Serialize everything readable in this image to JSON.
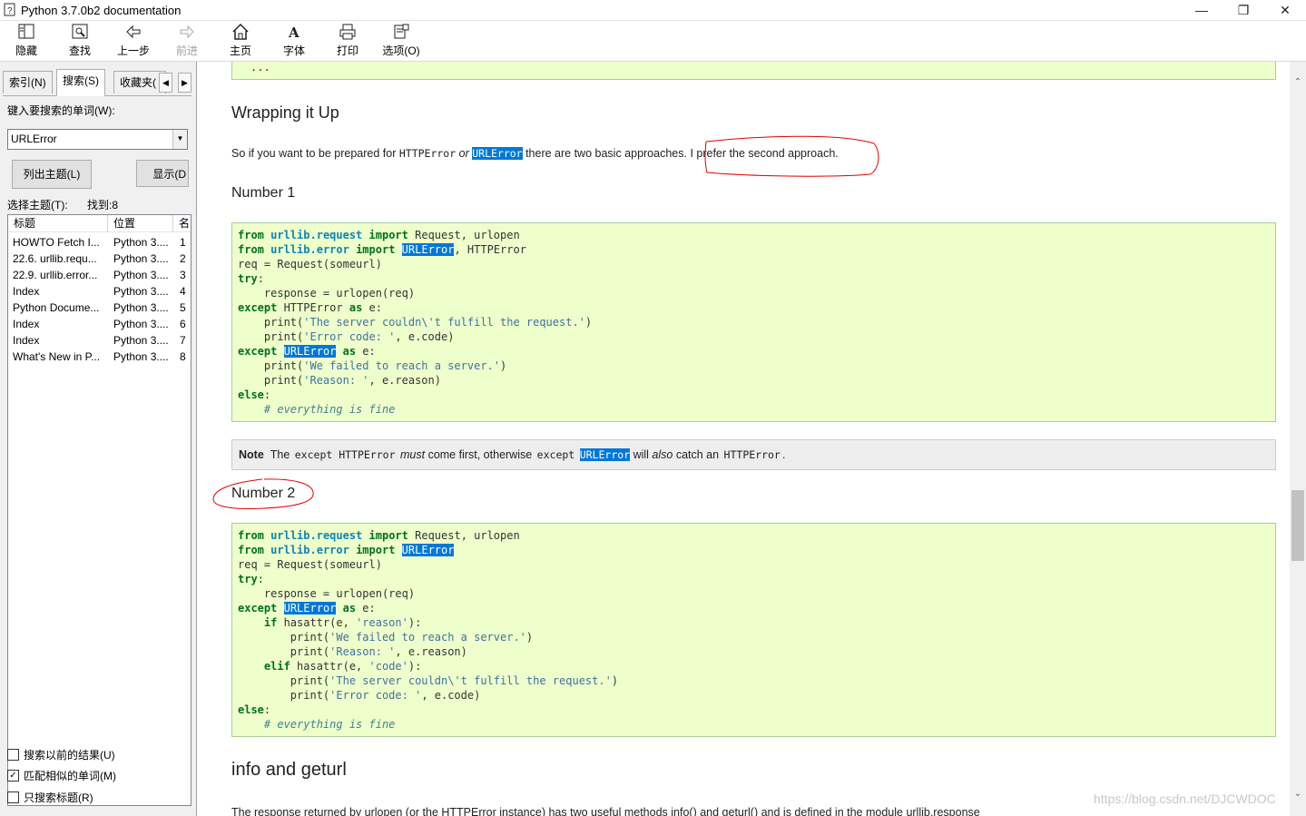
{
  "window": {
    "title": "Python 3.7.0b2 documentation"
  },
  "toolbar": {
    "hide": "隐藏",
    "find": "查找",
    "back": "上一步",
    "forward": "前进",
    "home": "主页",
    "font": "字体",
    "print": "打印",
    "options": "选项(O)"
  },
  "left": {
    "tabs": {
      "index": "索引(N)",
      "search": "搜索(S)",
      "favorites": "收藏夹("
    },
    "search_label": "键入要搜索的单词(W):",
    "search_value": "URLError",
    "list_topics_button": "列出主题(L)",
    "display_button": "显示(D",
    "select_topic_label": "选择主题(T):",
    "found_label": "找到:8",
    "columns": {
      "title": "标题",
      "location": "位置",
      "rank": "名"
    },
    "results": [
      {
        "title": "HOWTO Fetch I...",
        "location": "Python 3....",
        "rank": "1"
      },
      {
        "title": "22.6. urllib.requ...",
        "location": "Python 3....",
        "rank": "2"
      },
      {
        "title": "22.9. urllib.error...",
        "location": "Python 3....",
        "rank": "3"
      },
      {
        "title": "Index",
        "location": "Python 3....",
        "rank": "4"
      },
      {
        "title": "Python Docume...",
        "location": "Python 3....",
        "rank": "5"
      },
      {
        "title": "Index",
        "location": "Python 3....",
        "rank": "6"
      },
      {
        "title": "Index",
        "location": "Python 3....",
        "rank": "7"
      },
      {
        "title": "What's New in P...",
        "location": "Python 3....",
        "rank": "8"
      }
    ],
    "options": {
      "prev_results": "搜索以前的结果(U)",
      "match_similar": "匹配相似的单词(M)",
      "titles_only": "只搜索标题(R)"
    },
    "checked": {
      "prev_results": false,
      "match_similar": true,
      "titles_only": false
    }
  },
  "content": {
    "top_code": "...",
    "heading_wrap": "Wrapping it Up",
    "intro": {
      "a": "So if you want to be prepared for ",
      "httperror": "HTTPError",
      "or": " or ",
      "urlerror": "URLError",
      "b": " there are two basic approaches.",
      "c": " I prefer the second approach."
    },
    "number1": "Number 1",
    "note": {
      "label": "Note",
      "t1": "The ",
      "c1": "except HTTPError",
      "t2": " must",
      "t3": " come first, otherwise ",
      "c2": "except",
      "c3": "URLError",
      "t4": " will ",
      "t5": "also",
      "t6": " catch an ",
      "c4": "HTTPError",
      "t7": "."
    },
    "number2": "Number 2",
    "heading_info": "info and geturl",
    "bottom_para": "The response returned by urlopen (or the HTTPError instance) has two useful methods info() and geturl() and is defined in the module urllib.response"
  },
  "watermark": "https://blog.csdn.net/DJCWDOC",
  "colors": {
    "code_bg": "#eeffcc",
    "highlight": "#0078d7",
    "annotation": "#e00000"
  }
}
